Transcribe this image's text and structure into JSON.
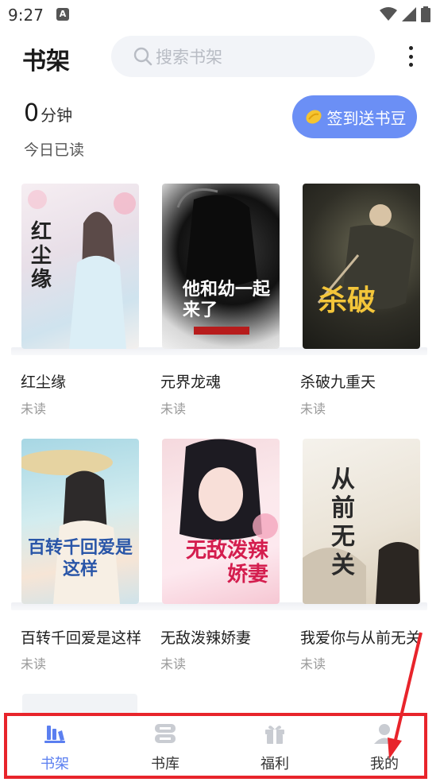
{
  "status_bar": {
    "time": "9:27",
    "notification_badge": "A"
  },
  "header": {
    "title": "书架",
    "search_placeholder": "搜索书架",
    "more_icon": "more-vertical-icon"
  },
  "reading": {
    "minutes": "0",
    "minutes_unit": "分钟",
    "today_label": "今日已读",
    "checkin_label": "签到送书豆"
  },
  "books": [
    {
      "title": "红尘缘",
      "status": "未读",
      "cover_text": "红尘缘"
    },
    {
      "title": "元界龙魂",
      "status": "未读",
      "cover_text": "他和幼一起来了"
    },
    {
      "title": "杀破九重天",
      "status": "未读",
      "cover_text": "杀破"
    },
    {
      "title": "百转千回爱是这样",
      "status": "未读",
      "cover_text": "百转千回爱是这样"
    },
    {
      "title": "无敌泼辣娇妻",
      "status": "未读",
      "cover_text": "无敌泼辣娇妻"
    },
    {
      "title": "我爱你与从前无关",
      "status": "未读",
      "cover_text": "从前无关"
    }
  ],
  "nav": [
    {
      "label": "书架",
      "icon": "bookshelf-icon",
      "active": true
    },
    {
      "label": "书库",
      "icon": "library-icon",
      "active": false
    },
    {
      "label": "福利",
      "icon": "gift-icon",
      "active": false
    },
    {
      "label": "我的",
      "icon": "profile-icon",
      "active": false
    }
  ],
  "colors": {
    "accent": "#5b7ff0",
    "checkin_bg": "#6b8ff5",
    "annotation": "#e8242b"
  }
}
